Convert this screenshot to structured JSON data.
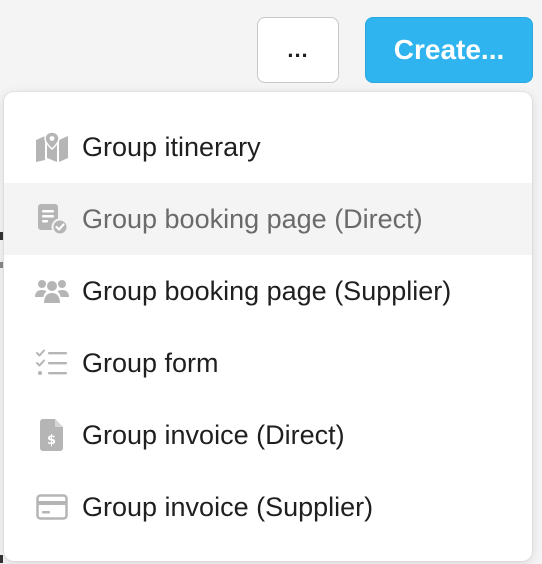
{
  "toolbar": {
    "more_label": "...",
    "create_label": "Create..."
  },
  "menu": {
    "items": [
      {
        "label": "Group itinerary",
        "icon": "map-pin-icon",
        "highlighted": false
      },
      {
        "label": "Group booking page (Direct)",
        "icon": "booking-check-icon",
        "highlighted": true
      },
      {
        "label": "Group booking page (Supplier)",
        "icon": "users-group-icon",
        "highlighted": false
      },
      {
        "label": "Group form",
        "icon": "checklist-icon",
        "highlighted": false
      },
      {
        "label": "Group invoice (Direct)",
        "icon": "invoice-dollar-icon",
        "highlighted": false
      },
      {
        "label": "Group invoice (Supplier)",
        "icon": "credit-card-icon",
        "highlighted": false
      }
    ]
  },
  "colors": {
    "accent": "#2fb4ef",
    "icon_gray": "#b5b5b5",
    "highlight_bg": "#f4f4f4"
  }
}
